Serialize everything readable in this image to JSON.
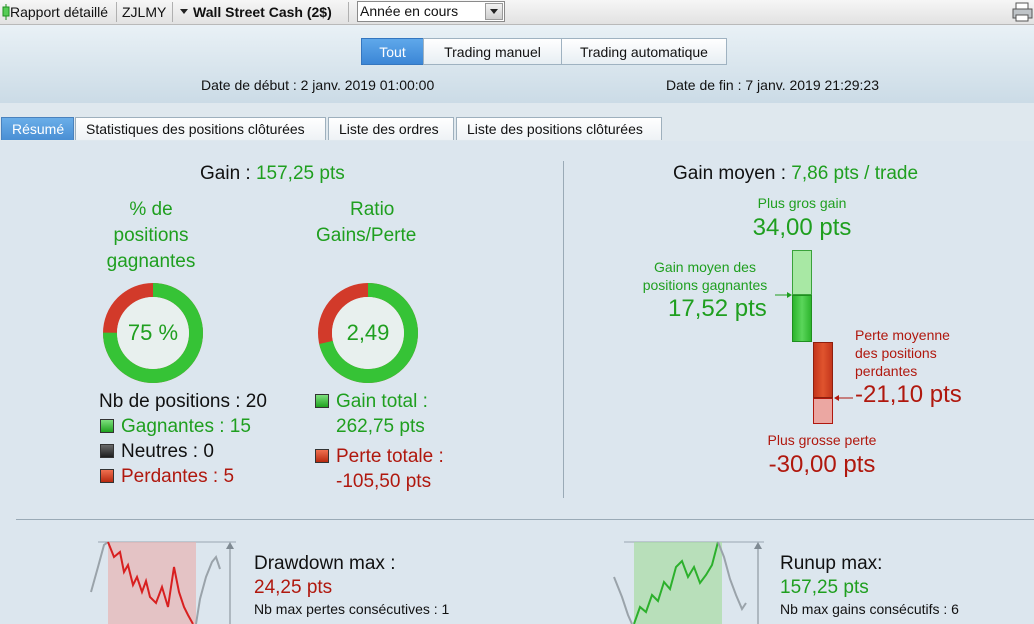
{
  "toolbar": {
    "report_label": "Rapport détaillé",
    "account": "ZJLMY",
    "market": "Wall Street Cash (2$)",
    "period": "Année en cours"
  },
  "filter_tabs": [
    "Tout",
    "Trading manuel",
    "Trading automatique"
  ],
  "dates": {
    "start": "Date de début : 2 janv. 2019 01:00:00",
    "end": "Date de fin : 7 janv. 2019 21:29:23"
  },
  "tabs": [
    "Résumé",
    "Statistiques des positions clôturées",
    "Liste des ordres",
    "Liste des positions clôturées"
  ],
  "gain": {
    "label": "Gain : ",
    "value": "157,25 pts"
  },
  "winrate": {
    "title1": "% de",
    "title2": "positions",
    "title3": "gagnantes",
    "value_text": "75 %",
    "fraction": 0.75
  },
  "ratio": {
    "title1": "Ratio",
    "title2": "Gains/Perte",
    "value_text": "2,49",
    "fraction": 0.7135
  },
  "positions": {
    "count_label": "Nb de positions : 20",
    "winners": "Gagnantes : 15",
    "neutral": "Neutres : 0",
    "losers": "Perdantes : 5"
  },
  "totals": {
    "gain_label": "Gain total :",
    "gain_value": "262,75 pts",
    "loss_label": "Perte totale :",
    "loss_value": "-105,50 pts"
  },
  "avg": {
    "label": "Gain moyen : ",
    "value": "7,86 pts / trade",
    "max_gain_label": "Plus gros gain",
    "max_gain_value": "34,00 pts",
    "avg_win_label1": "Gain moyen des",
    "avg_win_label2": "positions gagnantes",
    "avg_win_value": "17,52 pts",
    "avg_loss_label1": "Perte moyenne",
    "avg_loss_label2": "des positions",
    "avg_loss_label3": "perdantes",
    "avg_loss_value": "-21,10 pts",
    "max_loss_label": "Plus grosse perte",
    "max_loss_value": "-30,00 pts"
  },
  "drawdown": {
    "label": "Drawdown max :",
    "value": "24,25 pts",
    "sub": "Nb max pertes consécutives : 1"
  },
  "runup": {
    "label": "Runup max:",
    "value": "157,25 pts",
    "sub": "Nb max gains consécutifs : 6"
  },
  "colors": {
    "green": "#1f9f1f",
    "red": "#b0180e",
    "accent": "#3b86d6"
  }
}
